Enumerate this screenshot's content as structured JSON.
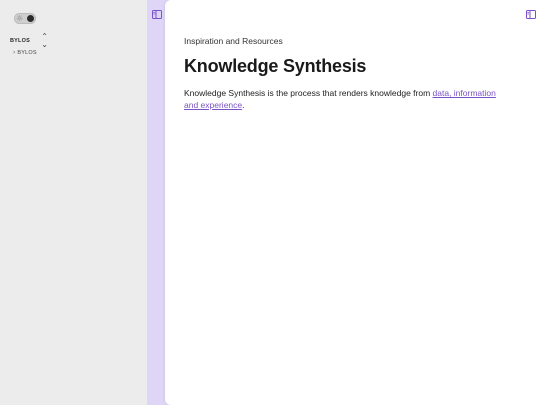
{
  "sidebar": {
    "theme_toggle": {
      "icon": "sun-icon",
      "state": "dark"
    },
    "vault": {
      "name": "BYLOS",
      "switch_icon": "chevron-up-down-icon"
    },
    "tree": [
      {
        "label": "BYLOS",
        "icon": "chevron-right-icon"
      }
    ]
  },
  "page": {
    "breadcrumb": "Inspiration and Resources",
    "title": "Knowledge Synthesis",
    "paragraph_before": "Knowledge Synthesis is the process that renders knowledge from ",
    "link_text": "data, information and experience",
    "paragraph_after": "."
  },
  "colors": {
    "accent": "#7a52c7",
    "ribbon": "#ded5f7",
    "sidebar": "#ececec",
    "content": "#ffffff"
  }
}
